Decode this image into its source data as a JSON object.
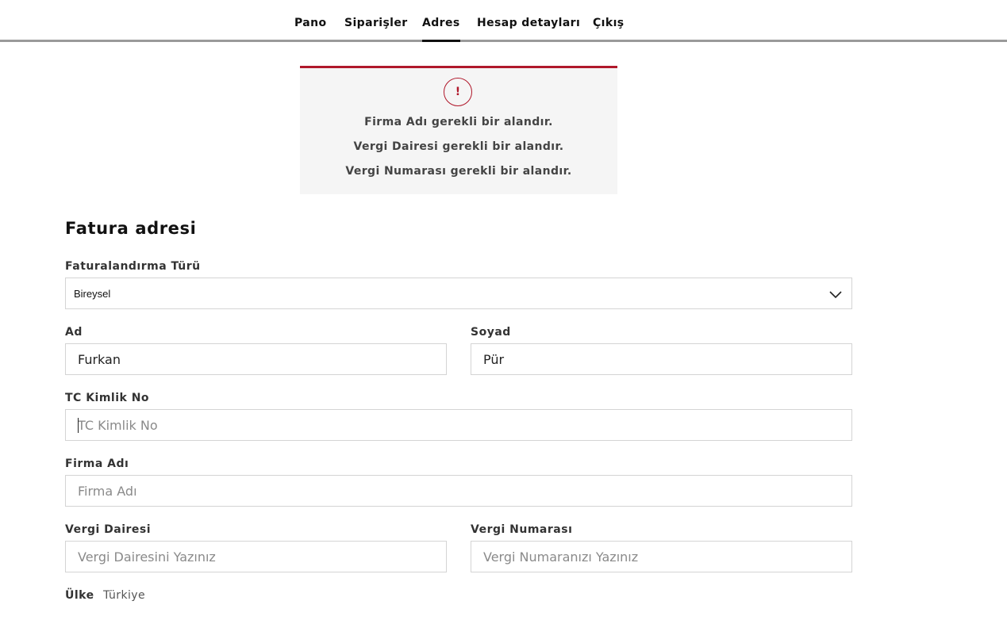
{
  "nav": {
    "tabs": [
      {
        "label": "Pano"
      },
      {
        "label": "Siparişler"
      },
      {
        "label": "Adres"
      },
      {
        "label": "Hesap detayları"
      },
      {
        "label": "Çıkış"
      }
    ],
    "active": "Adres"
  },
  "notice": {
    "icon": "!",
    "errors": [
      "Firma Adı gerekli bir alandır.",
      "Vergi Dairesi gerekli bir alandır.",
      "Vergi Numarası gerekli bir alandır."
    ],
    "accent_color": "#b0182b"
  },
  "form": {
    "title": "Fatura adresi",
    "billing_type": {
      "label": "Faturalandırma Türü",
      "value": "Bireysel"
    },
    "first_name": {
      "label": "Ad",
      "value": "Furkan"
    },
    "last_name": {
      "label": "Soyad",
      "value": "Pür"
    },
    "tc_no": {
      "label": "TC Kimlik No",
      "value": "",
      "placeholder": "TC Kimlik No"
    },
    "company": {
      "label": "Firma Adı",
      "value": "",
      "placeholder": "Firma Adı"
    },
    "tax_office": {
      "label": "Vergi Dairesi",
      "value": "",
      "placeholder": "Vergi Dairesini Yazınız"
    },
    "tax_number": {
      "label": "Vergi Numarası",
      "value": "",
      "placeholder": "Vergi Numaranızı Yazınız"
    },
    "country": {
      "label": "Ülke",
      "value": "Türkiye"
    }
  }
}
